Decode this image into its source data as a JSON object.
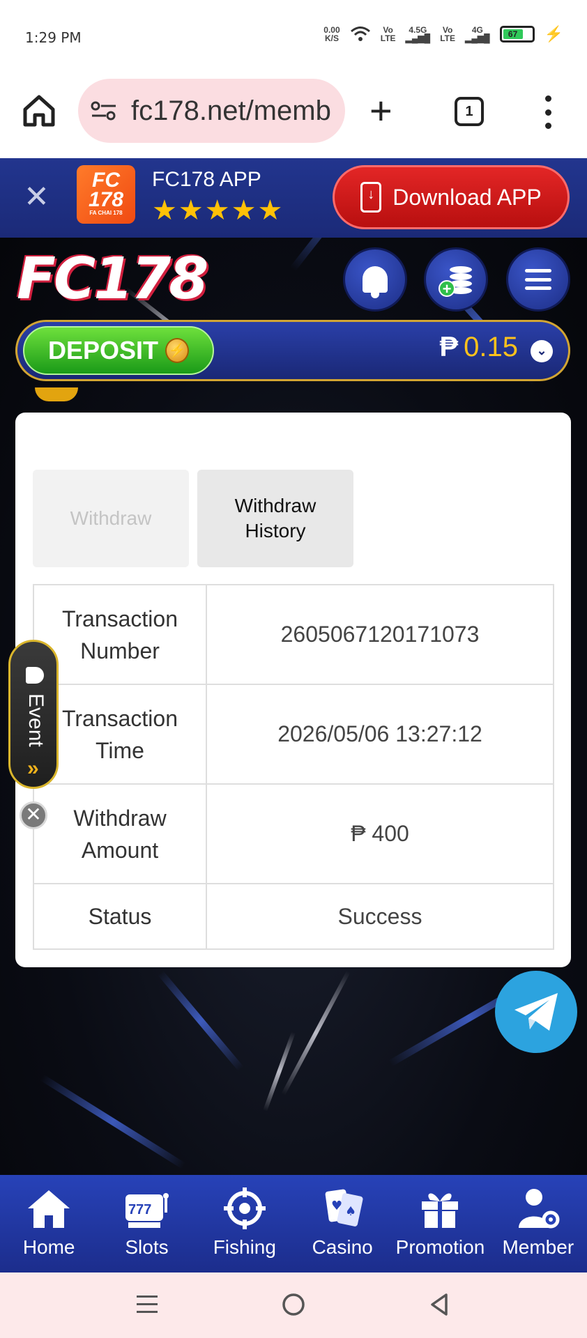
{
  "status_bar": {
    "time": "1:29 PM",
    "net_speed": "0.00",
    "net_unit": "K/S",
    "sim1_tag": "Vo LTE",
    "sim1_net": "4.5G",
    "sim2_tag": "Vo LTE",
    "sim2_net": "4G",
    "battery": "67"
  },
  "browser": {
    "url": "fc178.net/memb",
    "tab_count": "1"
  },
  "app_banner": {
    "app_logo_text": "FC 178",
    "app_logo_sub": "FA CHAI 178",
    "app_name": "FC178 APP",
    "rating_stars": "★★★★★",
    "download_label": "Download APP"
  },
  "site": {
    "logo": "FC178",
    "deposit_label": "DEPOSIT",
    "currency_symbol": "₱",
    "balance": "0.15"
  },
  "card": {
    "tabs": [
      {
        "label": "Withdraw",
        "active": false
      },
      {
        "label": "Withdraw History",
        "active": true
      }
    ],
    "rows": [
      {
        "key": "Transaction Number",
        "value": "2605067120171073"
      },
      {
        "key": "Transaction Time",
        "value": "2026/05/06 13:27:12"
      },
      {
        "key": "Withdraw Amount",
        "value": "₱ 400"
      },
      {
        "key": "Status",
        "value": "Success"
      }
    ]
  },
  "event_tab": {
    "label": "Event"
  },
  "bottom_nav": [
    {
      "label": "Home",
      "icon": "home-icon"
    },
    {
      "label": "Slots",
      "icon": "slots-icon"
    },
    {
      "label": "Fishing",
      "icon": "crosshair-icon"
    },
    {
      "label": "Casino",
      "icon": "cards-icon"
    },
    {
      "label": "Promotion",
      "icon": "gift-icon"
    },
    {
      "label": "Member",
      "icon": "member-icon"
    }
  ],
  "colors": {
    "banner_blue": "#22358e",
    "download_red": "#e32626",
    "deposit_green": "#1a9a18",
    "balance_gold": "#ffc21c",
    "nav_blue": "#2742b8",
    "telegram_blue": "#2ca3df"
  }
}
